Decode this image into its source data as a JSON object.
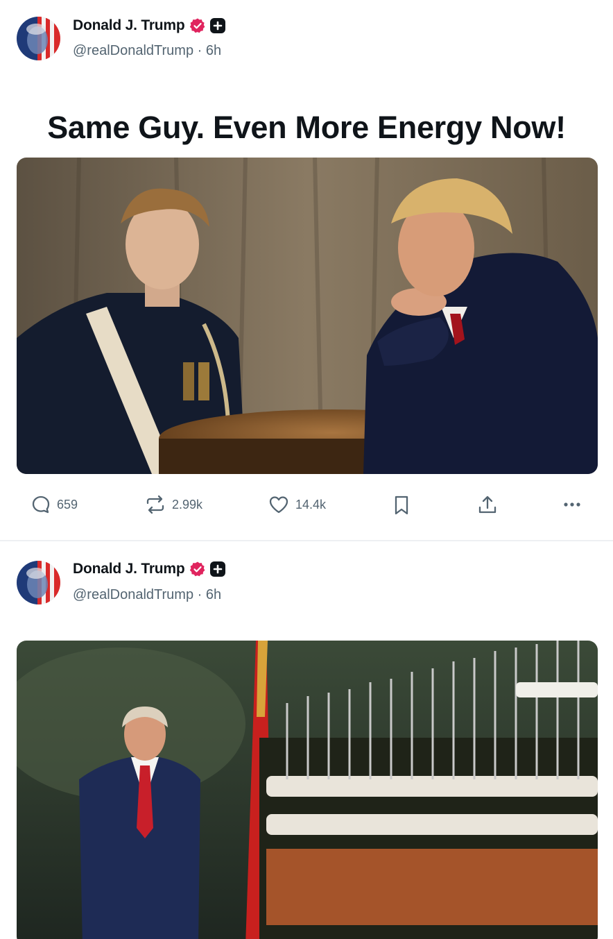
{
  "posts": [
    {
      "author": {
        "name": "Donald J. Trump",
        "handle": "@realDonaldTrump",
        "separator": "·",
        "time": "6h"
      },
      "headline": "Same Guy. Even More Energy Now!",
      "media_description_icon": "photo",
      "stats": {
        "replies": "659",
        "reposts": "2.99k",
        "likes": "14.4k"
      }
    },
    {
      "author": {
        "name": "Donald J. Trump",
        "handle": "@realDonaldTrump",
        "separator": "·",
        "time": "6h"
      },
      "media_description_icon": "photo"
    }
  ],
  "colors": {
    "badge": "#e0245e",
    "text": "#0f1419",
    "secondary": "#536471",
    "divider": "#eef0f2"
  },
  "icons": [
    "reply-icon",
    "repost-icon",
    "like-icon",
    "bookmark-icon",
    "share-icon",
    "more-icon",
    "verified-badge-icon",
    "plus-icon"
  ]
}
